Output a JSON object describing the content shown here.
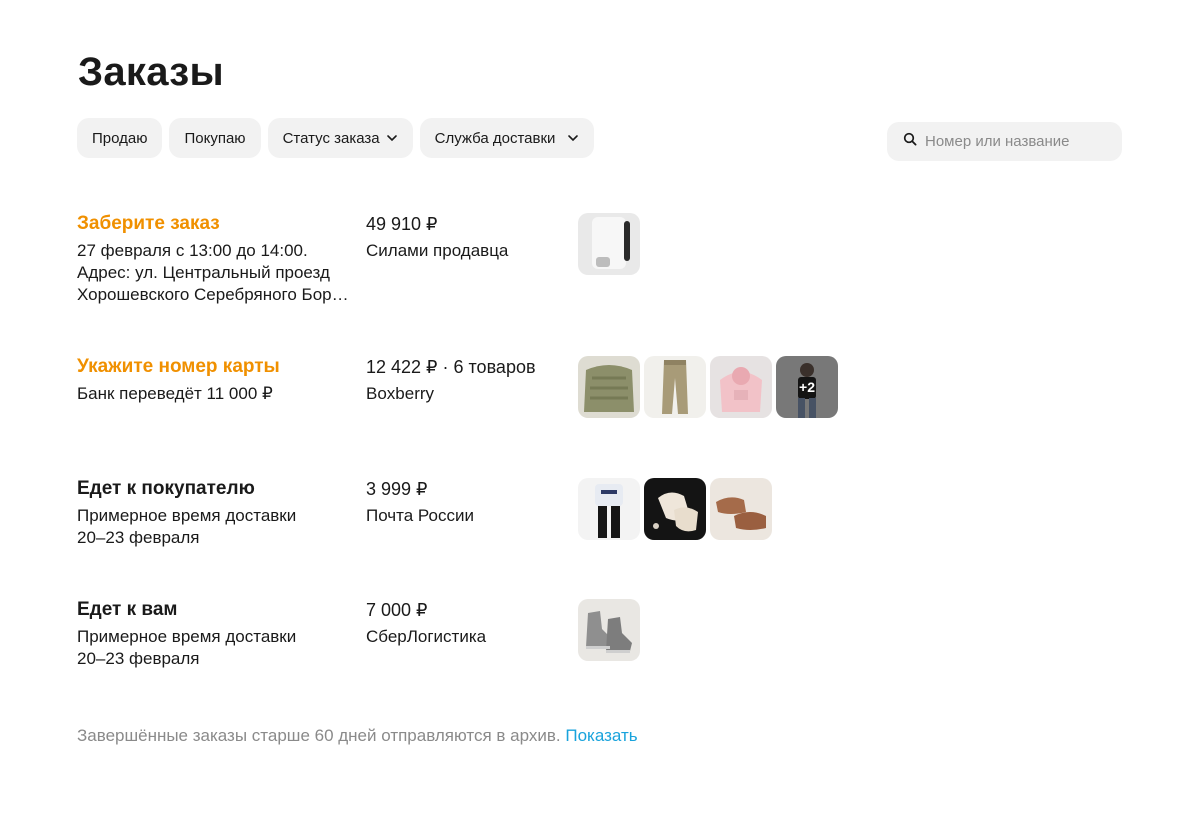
{
  "page": {
    "title": "Заказы"
  },
  "filters": {
    "sell": "Продаю",
    "buy": "Покупаю",
    "status": "Статус заказа",
    "delivery": "Служба доставки"
  },
  "search": {
    "placeholder": "Номер или название",
    "value": ""
  },
  "colors": {
    "accent": "#f09000",
    "link": "#19a3dc",
    "muted": "#8a8a8a",
    "chip_bg": "#f2f2f2"
  },
  "orders": [
    {
      "status": "Заберите заказ",
      "details": [
        "27 февраля с 13:00 до 14:00.",
        "Адрес: ул. Центральный проезд",
        "Хорошевского Серебряного Бор…"
      ],
      "price": "49 910 ₽",
      "carrier": "Силами продавца",
      "thumbnails": [
        "white-device-photo"
      ]
    },
    {
      "status": "Укажите номер карты",
      "details": [
        "Банк переведёт 11 000 ₽"
      ],
      "price": "12 422 ₽ · 6 товаров",
      "carrier": "Boxberry",
      "thumbnails": [
        "green-knit-sweater-photo",
        "beige-trousers-photo",
        "pink-hoodie-photo",
        "person-photo"
      ],
      "more_label": "+2"
    },
    {
      "status": "Едет к покупателю",
      "details": [
        "Примерное время доставки",
        "20–23 февраля"
      ],
      "price": "3 999 ₽",
      "carrier": "Почта России",
      "thumbnails": [
        "outfit-photo",
        "sneakers-photo",
        "brown-shoes-photo"
      ]
    },
    {
      "status": "Едет к вам",
      "details": [
        "Примерное время доставки",
        "20–23 февраля"
      ],
      "price": "7 000 ₽",
      "carrier": "СберЛогистика",
      "thumbnails": [
        "grey-boots-photo"
      ]
    }
  ],
  "footer": {
    "note": "Завершённые заказы старше 60 дней  отправляются в архив.",
    "link": "Показать"
  }
}
